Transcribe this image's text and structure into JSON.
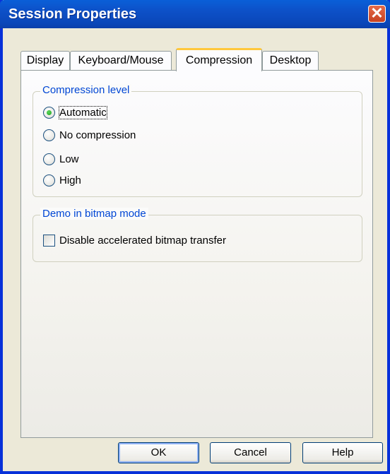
{
  "window": {
    "title": "Session Properties"
  },
  "tabs": [
    {
      "label": "Display"
    },
    {
      "label": "Keyboard/Mouse"
    },
    {
      "label": "Compression",
      "active": true
    },
    {
      "label": "Desktop"
    }
  ],
  "compression_group": {
    "legend": "Compression level",
    "options": [
      {
        "label": "Automatic",
        "checked": true
      },
      {
        "label": "No compression",
        "checked": false
      },
      {
        "label": "Low",
        "checked": false
      },
      {
        "label": "High",
        "checked": false
      }
    ]
  },
  "demo_group": {
    "legend": "Demo in bitmap mode",
    "checkbox_label": "Disable accelerated bitmap transfer",
    "checked": false
  },
  "buttons": {
    "ok": "OK",
    "cancel": "Cancel",
    "help": "Help"
  }
}
